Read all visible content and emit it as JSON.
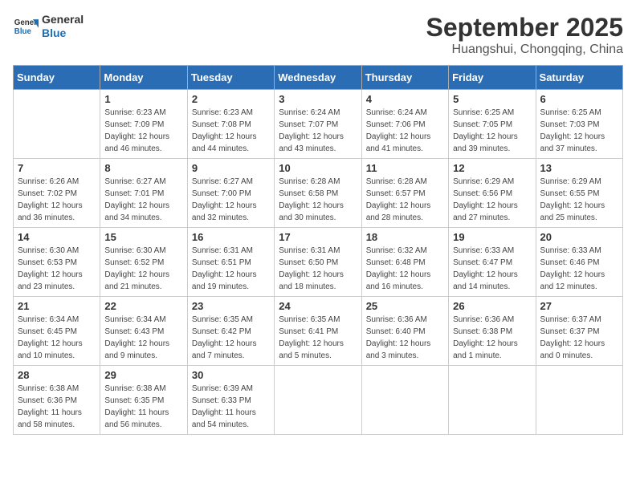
{
  "header": {
    "logo_general": "General",
    "logo_blue": "Blue",
    "title": "September 2025",
    "subtitle": "Huangshui, Chongqing, China"
  },
  "weekdays": [
    "Sunday",
    "Monday",
    "Tuesday",
    "Wednesday",
    "Thursday",
    "Friday",
    "Saturday"
  ],
  "weeks": [
    [
      {
        "day": "",
        "info": ""
      },
      {
        "day": "1",
        "info": "Sunrise: 6:23 AM\nSunset: 7:09 PM\nDaylight: 12 hours\nand 46 minutes."
      },
      {
        "day": "2",
        "info": "Sunrise: 6:23 AM\nSunset: 7:08 PM\nDaylight: 12 hours\nand 44 minutes."
      },
      {
        "day": "3",
        "info": "Sunrise: 6:24 AM\nSunset: 7:07 PM\nDaylight: 12 hours\nand 43 minutes."
      },
      {
        "day": "4",
        "info": "Sunrise: 6:24 AM\nSunset: 7:06 PM\nDaylight: 12 hours\nand 41 minutes."
      },
      {
        "day": "5",
        "info": "Sunrise: 6:25 AM\nSunset: 7:05 PM\nDaylight: 12 hours\nand 39 minutes."
      },
      {
        "day": "6",
        "info": "Sunrise: 6:25 AM\nSunset: 7:03 PM\nDaylight: 12 hours\nand 37 minutes."
      }
    ],
    [
      {
        "day": "7",
        "info": "Sunrise: 6:26 AM\nSunset: 7:02 PM\nDaylight: 12 hours\nand 36 minutes."
      },
      {
        "day": "8",
        "info": "Sunrise: 6:27 AM\nSunset: 7:01 PM\nDaylight: 12 hours\nand 34 minutes."
      },
      {
        "day": "9",
        "info": "Sunrise: 6:27 AM\nSunset: 7:00 PM\nDaylight: 12 hours\nand 32 minutes."
      },
      {
        "day": "10",
        "info": "Sunrise: 6:28 AM\nSunset: 6:58 PM\nDaylight: 12 hours\nand 30 minutes."
      },
      {
        "day": "11",
        "info": "Sunrise: 6:28 AM\nSunset: 6:57 PM\nDaylight: 12 hours\nand 28 minutes."
      },
      {
        "day": "12",
        "info": "Sunrise: 6:29 AM\nSunset: 6:56 PM\nDaylight: 12 hours\nand 27 minutes."
      },
      {
        "day": "13",
        "info": "Sunrise: 6:29 AM\nSunset: 6:55 PM\nDaylight: 12 hours\nand 25 minutes."
      }
    ],
    [
      {
        "day": "14",
        "info": "Sunrise: 6:30 AM\nSunset: 6:53 PM\nDaylight: 12 hours\nand 23 minutes."
      },
      {
        "day": "15",
        "info": "Sunrise: 6:30 AM\nSunset: 6:52 PM\nDaylight: 12 hours\nand 21 minutes."
      },
      {
        "day": "16",
        "info": "Sunrise: 6:31 AM\nSunset: 6:51 PM\nDaylight: 12 hours\nand 19 minutes."
      },
      {
        "day": "17",
        "info": "Sunrise: 6:31 AM\nSunset: 6:50 PM\nDaylight: 12 hours\nand 18 minutes."
      },
      {
        "day": "18",
        "info": "Sunrise: 6:32 AM\nSunset: 6:48 PM\nDaylight: 12 hours\nand 16 minutes."
      },
      {
        "day": "19",
        "info": "Sunrise: 6:33 AM\nSunset: 6:47 PM\nDaylight: 12 hours\nand 14 minutes."
      },
      {
        "day": "20",
        "info": "Sunrise: 6:33 AM\nSunset: 6:46 PM\nDaylight: 12 hours\nand 12 minutes."
      }
    ],
    [
      {
        "day": "21",
        "info": "Sunrise: 6:34 AM\nSunset: 6:45 PM\nDaylight: 12 hours\nand 10 minutes."
      },
      {
        "day": "22",
        "info": "Sunrise: 6:34 AM\nSunset: 6:43 PM\nDaylight: 12 hours\nand 9 minutes."
      },
      {
        "day": "23",
        "info": "Sunrise: 6:35 AM\nSunset: 6:42 PM\nDaylight: 12 hours\nand 7 minutes."
      },
      {
        "day": "24",
        "info": "Sunrise: 6:35 AM\nSunset: 6:41 PM\nDaylight: 12 hours\nand 5 minutes."
      },
      {
        "day": "25",
        "info": "Sunrise: 6:36 AM\nSunset: 6:40 PM\nDaylight: 12 hours\nand 3 minutes."
      },
      {
        "day": "26",
        "info": "Sunrise: 6:36 AM\nSunset: 6:38 PM\nDaylight: 12 hours\nand 1 minute."
      },
      {
        "day": "27",
        "info": "Sunrise: 6:37 AM\nSunset: 6:37 PM\nDaylight: 12 hours\nand 0 minutes."
      }
    ],
    [
      {
        "day": "28",
        "info": "Sunrise: 6:38 AM\nSunset: 6:36 PM\nDaylight: 11 hours\nand 58 minutes."
      },
      {
        "day": "29",
        "info": "Sunrise: 6:38 AM\nSunset: 6:35 PM\nDaylight: 11 hours\nand 56 minutes."
      },
      {
        "day": "30",
        "info": "Sunrise: 6:39 AM\nSunset: 6:33 PM\nDaylight: 11 hours\nand 54 minutes."
      },
      {
        "day": "",
        "info": ""
      },
      {
        "day": "",
        "info": ""
      },
      {
        "day": "",
        "info": ""
      },
      {
        "day": "",
        "info": ""
      }
    ]
  ]
}
